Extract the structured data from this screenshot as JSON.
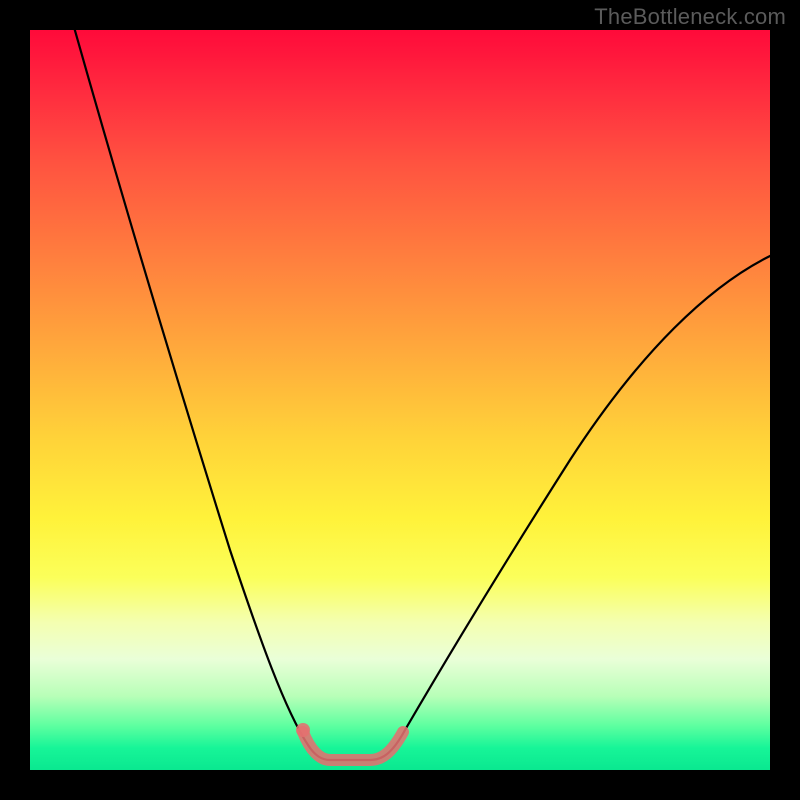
{
  "watermark": "TheBottleneck.com",
  "chart_data": {
    "type": "line",
    "title": "",
    "xlabel": "",
    "ylabel": "",
    "x": [
      0,
      5,
      10,
      15,
      20,
      25,
      30,
      33,
      36,
      38,
      40,
      42,
      44,
      48,
      55,
      65,
      75,
      85,
      95,
      100
    ],
    "values": [
      100,
      88,
      75,
      62,
      48,
      34,
      20,
      10,
      4,
      1,
      0,
      1,
      4,
      10,
      22,
      36,
      47,
      55,
      61,
      64
    ],
    "xlim": [
      0,
      100
    ],
    "ylim": [
      0,
      100
    ],
    "highlighted_range_x": [
      33,
      47
    ],
    "notes": "V-shaped bottleneck curve with minimum near x≈40; highlighted pink segment marks the low-bottleneck zone near the trough."
  },
  "colors": {
    "curve": "#000000",
    "highlight": "#e47070",
    "frame": "#000000"
  }
}
